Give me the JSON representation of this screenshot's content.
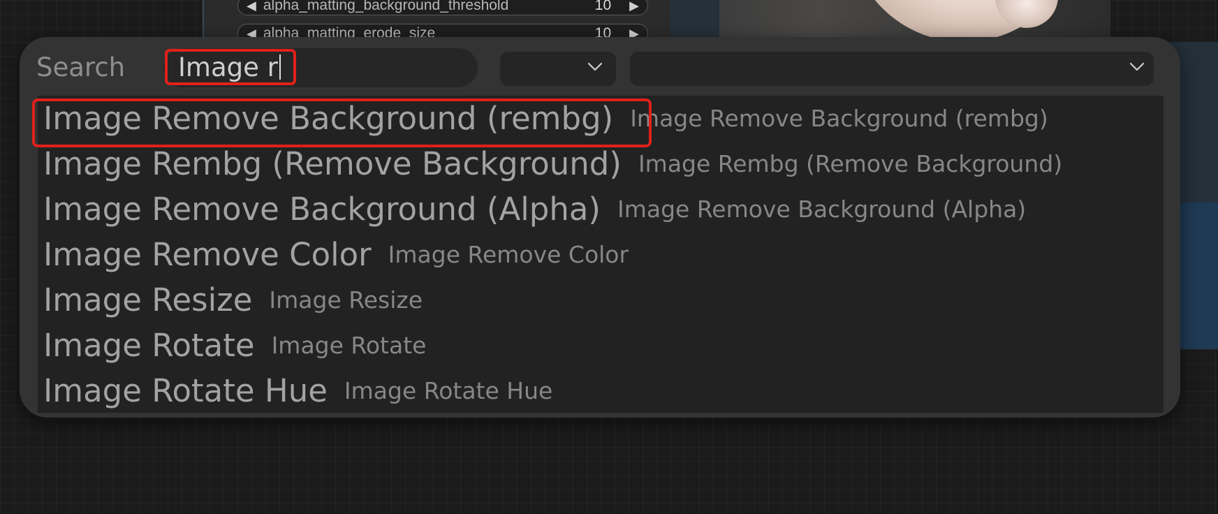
{
  "background": {
    "widgets": [
      {
        "label": "alpha_matting_background_threshold",
        "value": "10"
      },
      {
        "label": "alpha_matting_erode_size",
        "value": "10"
      }
    ]
  },
  "search": {
    "label": "Search",
    "query": "Image r",
    "filter_1": "",
    "filter_2": ""
  },
  "results": [
    {
      "name": "Image Remove Background (rembg)",
      "description": "Image Remove Background (rembg)",
      "highlighted": true
    },
    {
      "name": "Image Rembg (Remove Background)",
      "description": "Image Rembg (Remove Background)"
    },
    {
      "name": "Image Remove Background (Alpha)",
      "description": "Image Remove Background (Alpha)"
    },
    {
      "name": "Image Remove Color",
      "description": "Image Remove Color"
    },
    {
      "name": "Image Resize",
      "description": "Image Resize"
    },
    {
      "name": "Image Rotate",
      "description": "Image Rotate"
    },
    {
      "name": "Image Rotate Hue",
      "description": "Image Rotate Hue"
    }
  ],
  "colors": {
    "highlight": "#e0211b",
    "dialog": "#333333",
    "list": "#222222"
  }
}
